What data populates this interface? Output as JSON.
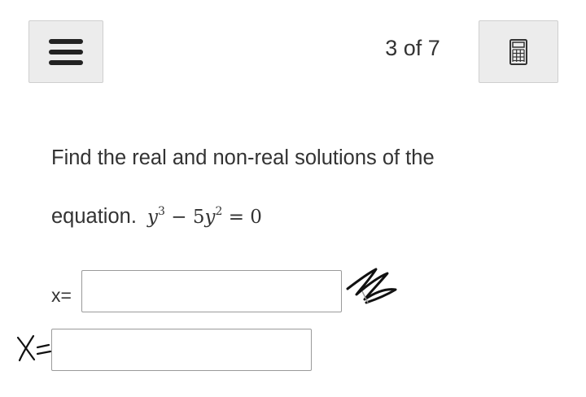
{
  "header": {
    "counter": "3 of 7"
  },
  "question": {
    "line1": "Find the real and non-real solutions of the",
    "line2_prefix": "equation."
  },
  "answers": [
    {
      "label": "x=",
      "value": ""
    },
    {
      "label": "",
      "value": ""
    }
  ],
  "icons": {
    "menu": "hamburger-menu-icon",
    "calculator": "calculator-icon"
  },
  "colors": {
    "button_bg": "#ececec",
    "text": "#333333",
    "input_border": "#9a9a9a"
  }
}
